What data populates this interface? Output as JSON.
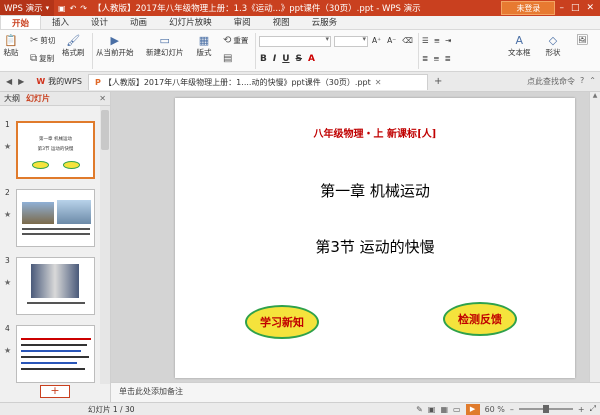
{
  "titlebar": {
    "app_name": "WPS 演示",
    "doc_title": "【人教版】2017年八年级物理上册：1.3《运动...》ppt课件（30页）.ppt - WPS 演示",
    "login_label": "未登录",
    "colors": {
      "bar": "#c9401f",
      "login": "#e77a31"
    }
  },
  "ribbon": {
    "tabs": [
      {
        "label": "开始",
        "active": true
      },
      {
        "label": "插入"
      },
      {
        "label": "设计"
      },
      {
        "label": "动画"
      },
      {
        "label": "幻灯片放映"
      },
      {
        "label": "审阅"
      },
      {
        "label": "视图"
      },
      {
        "label": "云服务"
      }
    ]
  },
  "toolbar": {
    "paste": "粘贴",
    "cut": "剪切",
    "copy": "复制",
    "format_painter": "格式刷",
    "from_current": "从当前开始",
    "new_slide": "新建幻灯片",
    "layout": "版式",
    "reset": "重置",
    "textbox": "文本框",
    "shape": "形状"
  },
  "doctabs": {
    "wps_tab": "我的WPS",
    "current_tab": "【人教版】2017年八年级物理上册：1....动的快慢》ppt课件（30页）.ppt",
    "right_hint": "点此查找命令"
  },
  "leftpanel": {
    "tab_outline": "大纲",
    "tab_slides": "幻灯片",
    "thumbs": [
      {
        "num": "1",
        "line1": "第一章  机械运动",
        "line2": "第3节  运动的快慢"
      },
      {
        "num": "2"
      },
      {
        "num": "3"
      },
      {
        "num": "4"
      }
    ]
  },
  "slide": {
    "header": "八年级物理・上      新课标[人]",
    "chapter": "第一章   机械运动",
    "section": "第3节    运动的快慢",
    "btn_learn": "学习新知",
    "btn_test": "检测反馈"
  },
  "notes_placeholder": "单击此处添加备注",
  "status": {
    "slide_pos": "幻灯片 1 / 30",
    "zoom": "60 %",
    "zoom_fraction": 0.5
  }
}
